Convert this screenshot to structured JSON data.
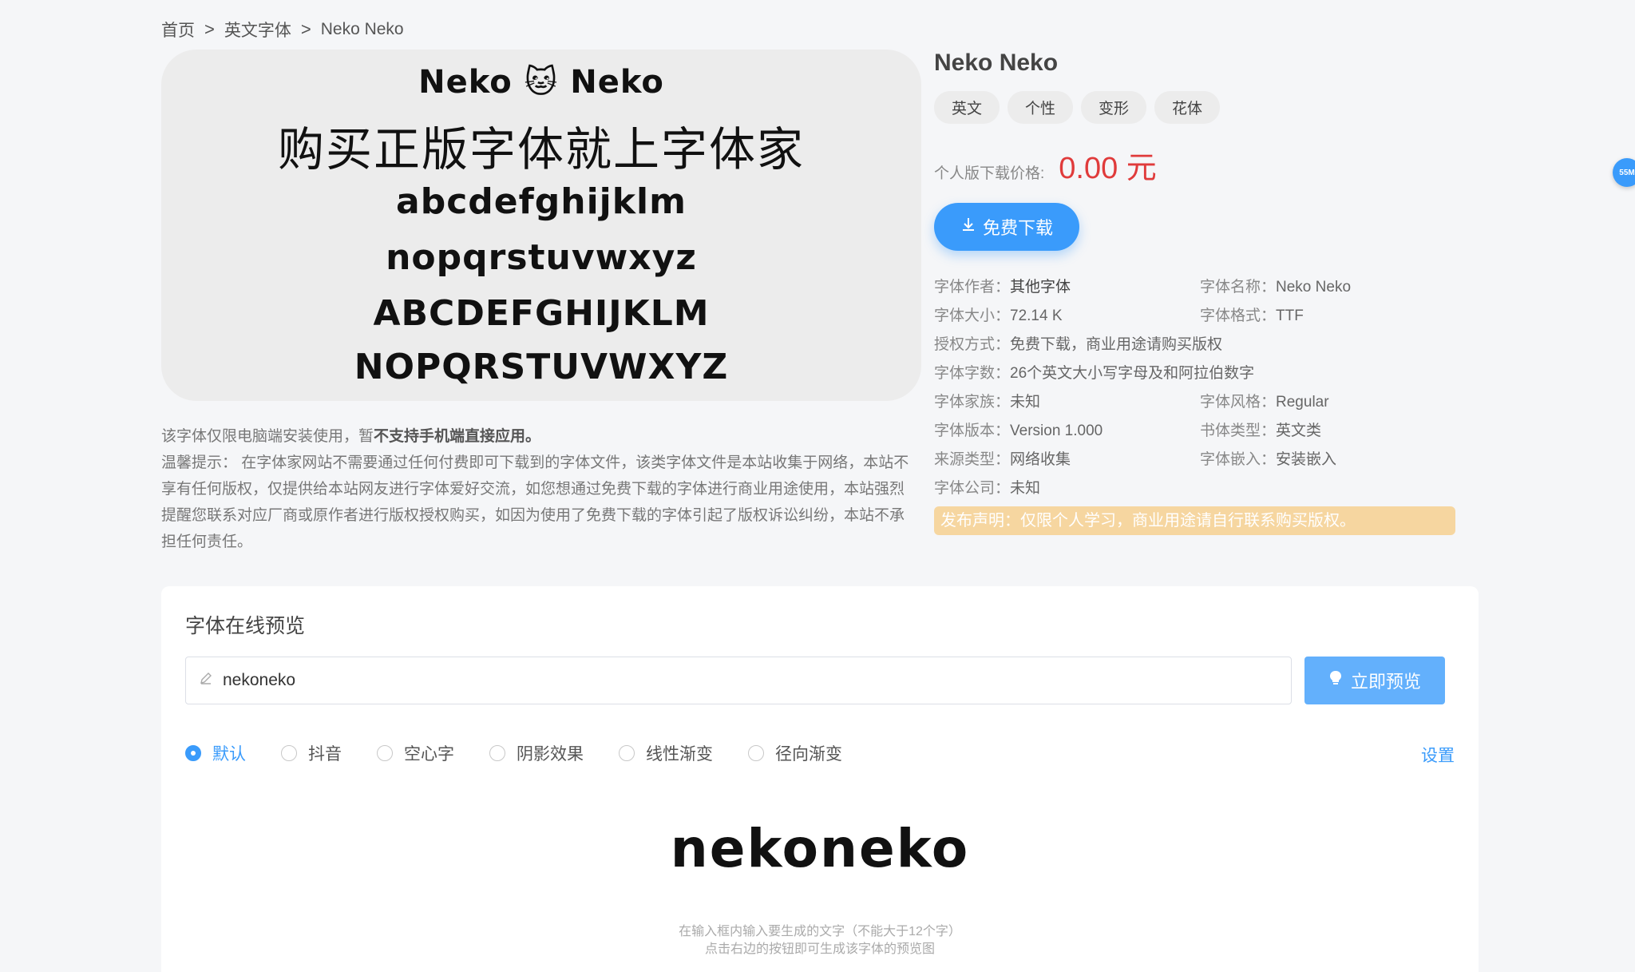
{
  "breadcrumb": {
    "home": "首页",
    "category": "英文字体",
    "current": "Neko Neko",
    "separator": ">"
  },
  "preview_image": {
    "title": "Neko 🐱 Neko",
    "slogan": "购买正版字体就上字体家",
    "line1": "abcdefghijklm",
    "line2": "nopqrstuvwxyz",
    "line3": "ABCDEFGHIJKLM",
    "line4": "NOPQRSTUVWXYZ"
  },
  "notice": {
    "line1_prefix": "该字体仅限电脑端安装使用，暂",
    "line1_bold": "不支持手机端直接应用。",
    "tip": "温馨提示： 在字体家网站不需要通过任何付费即可下载到的字体文件，该类字体文件是本站收集于网络，本站不享有任何版权，仅提供给本站网友进行字体爱好交流，如您想通过免费下载的字体进行商业用途使用，本站强烈提醒您联系对应厂商或原作者进行版权授权购买，如因为使用了免费下载的字体引起了版权诉讼纠纷，本站不承担任何责任。"
  },
  "info": {
    "title": "Neko Neko",
    "tags": [
      "英文",
      "个性",
      "变形",
      "花体"
    ],
    "price_label": "个人版下载价格:",
    "price_value": "0.00 元",
    "download_label": "免费下载",
    "meta": {
      "author_k": "字体作者：",
      "author_v": "其他字体",
      "name_k": "字体名称：",
      "name_v": "Neko Neko",
      "size_k": "字体大小：",
      "size_v": "72.14 K",
      "format_k": "字体格式：",
      "format_v": "TTF",
      "license_k": "授权方式：",
      "license_v": "免费下载，商业用途请购买版权",
      "chars_k": "字体字数：",
      "chars_v": "26个英文大小写字母及和阿拉伯数字",
      "family_k": "字体家族：",
      "family_v": "未知",
      "style_k": "字体风格：",
      "style_v": "Regular",
      "version_k": "字体版本：",
      "version_v": "Version 1.000",
      "type_k": "书体类型：",
      "type_v": "英文类",
      "source_k": "来源类型：",
      "source_v": "网络收集",
      "embed_k": "字体嵌入：",
      "embed_v": "安装嵌入",
      "company_k": "字体公司：",
      "company_v": "未知"
    },
    "claim": "发布声明：仅限个人学习，商业用途请自行联系购买版权。"
  },
  "online_preview": {
    "heading": "字体在线预览",
    "input_value": "nekoneko",
    "button_label": "立即预览",
    "effects": [
      "默认",
      "抖音",
      "空心字",
      "阴影效果",
      "线性渐变",
      "径向渐变"
    ],
    "selected_effect": "默认",
    "settings_label": "设置",
    "rendered_text": "nekoneko",
    "hint_line1": "在输入框内输入要生成的文字（不能大于12个字）",
    "hint_line2": "点击右边的按钮即可生成该字体的预览图"
  },
  "float_badge": "55M",
  "colors": {
    "accent": "#3a9bfb",
    "price": "#e03b3b",
    "claim_bg": "#f6d6a0"
  }
}
